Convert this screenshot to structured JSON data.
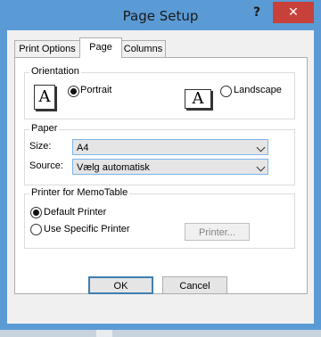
{
  "window": {
    "title": "Page Setup",
    "help_label": "?",
    "close_label": "✕"
  },
  "tabs": [
    {
      "label": "Print Options",
      "active": false
    },
    {
      "label": "Page",
      "active": true
    },
    {
      "label": "Columns",
      "active": false
    }
  ],
  "orientation": {
    "legend": "Orientation",
    "portrait_icon": "A",
    "portrait_label": "Portrait",
    "portrait_selected": true,
    "landscape_icon": "A",
    "landscape_label": "Landscape",
    "landscape_selected": false
  },
  "paper": {
    "legend": "Paper",
    "size_label": "Size:",
    "size_value": "A4",
    "source_label": "Source:",
    "source_value": "Vælg automatisk"
  },
  "printer": {
    "legend": "Printer for MemoTable",
    "default_label": "Default Printer",
    "default_selected": true,
    "specific_label": "Use Specific Printer",
    "specific_selected": false,
    "printer_button_label": "Printer..."
  },
  "buttons": {
    "ok_label": "OK",
    "cancel_label": "Cancel"
  }
}
